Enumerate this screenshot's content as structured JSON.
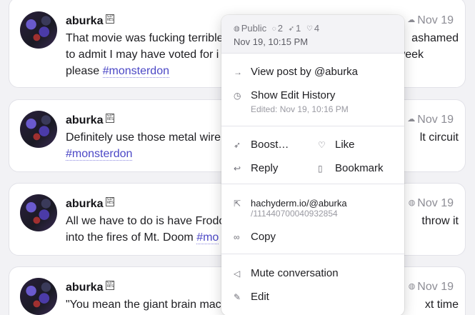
{
  "posts": [
    {
      "author": "aburka",
      "visibility_icon": "quote-icon",
      "date": "Nov 19",
      "line1": "That movie was fucking terrible",
      "line1_end": "ashamed",
      "line2": "to admit I may have voted for i",
      "line2_end": "week",
      "line3_prefix": "please ",
      "hashtag": "#monsterdon"
    },
    {
      "author": "aburka",
      "visibility_icon": "quote-icon",
      "date": "Nov 19",
      "line1": "Definitely use those metal wire",
      "line1_end": "lt circuit",
      "hashtag": "#monsterdon"
    },
    {
      "author": "aburka",
      "visibility_icon": "globe-icon",
      "date": "Nov 19",
      "line1": "All we have to do is have Frodo",
      "line1_end": "throw it",
      "line2_prefix": "into the fires of Mt. Doom ",
      "hashtag_partial": "#mo"
    },
    {
      "author": "aburka",
      "visibility_icon": "globe-icon",
      "date": "Nov 19",
      "line1": "\"You mean the giant brain mac",
      "line1_end": "xt time"
    }
  ],
  "menu": {
    "visibility": "Public",
    "replies": "2",
    "boosts": "1",
    "likes": "4",
    "datetime": "Nov 19, 10:15 PM",
    "view_post": "View post by @aburka",
    "edit_history": "Show Edit History",
    "edited": "Edited: Nov 19, 10:16 PM",
    "boost": "Boost…",
    "like": "Like",
    "reply": "Reply",
    "bookmark": "Bookmark",
    "url_line1": "hachyderm.io/@aburka",
    "url_line2": "/111440700040932854",
    "copy": "Copy",
    "mute": "Mute conversation",
    "edit": "Edit"
  },
  "colors": {
    "hashtag": "#4b47c6",
    "background": "#f2f2f5",
    "muted": "#8d8d95"
  }
}
